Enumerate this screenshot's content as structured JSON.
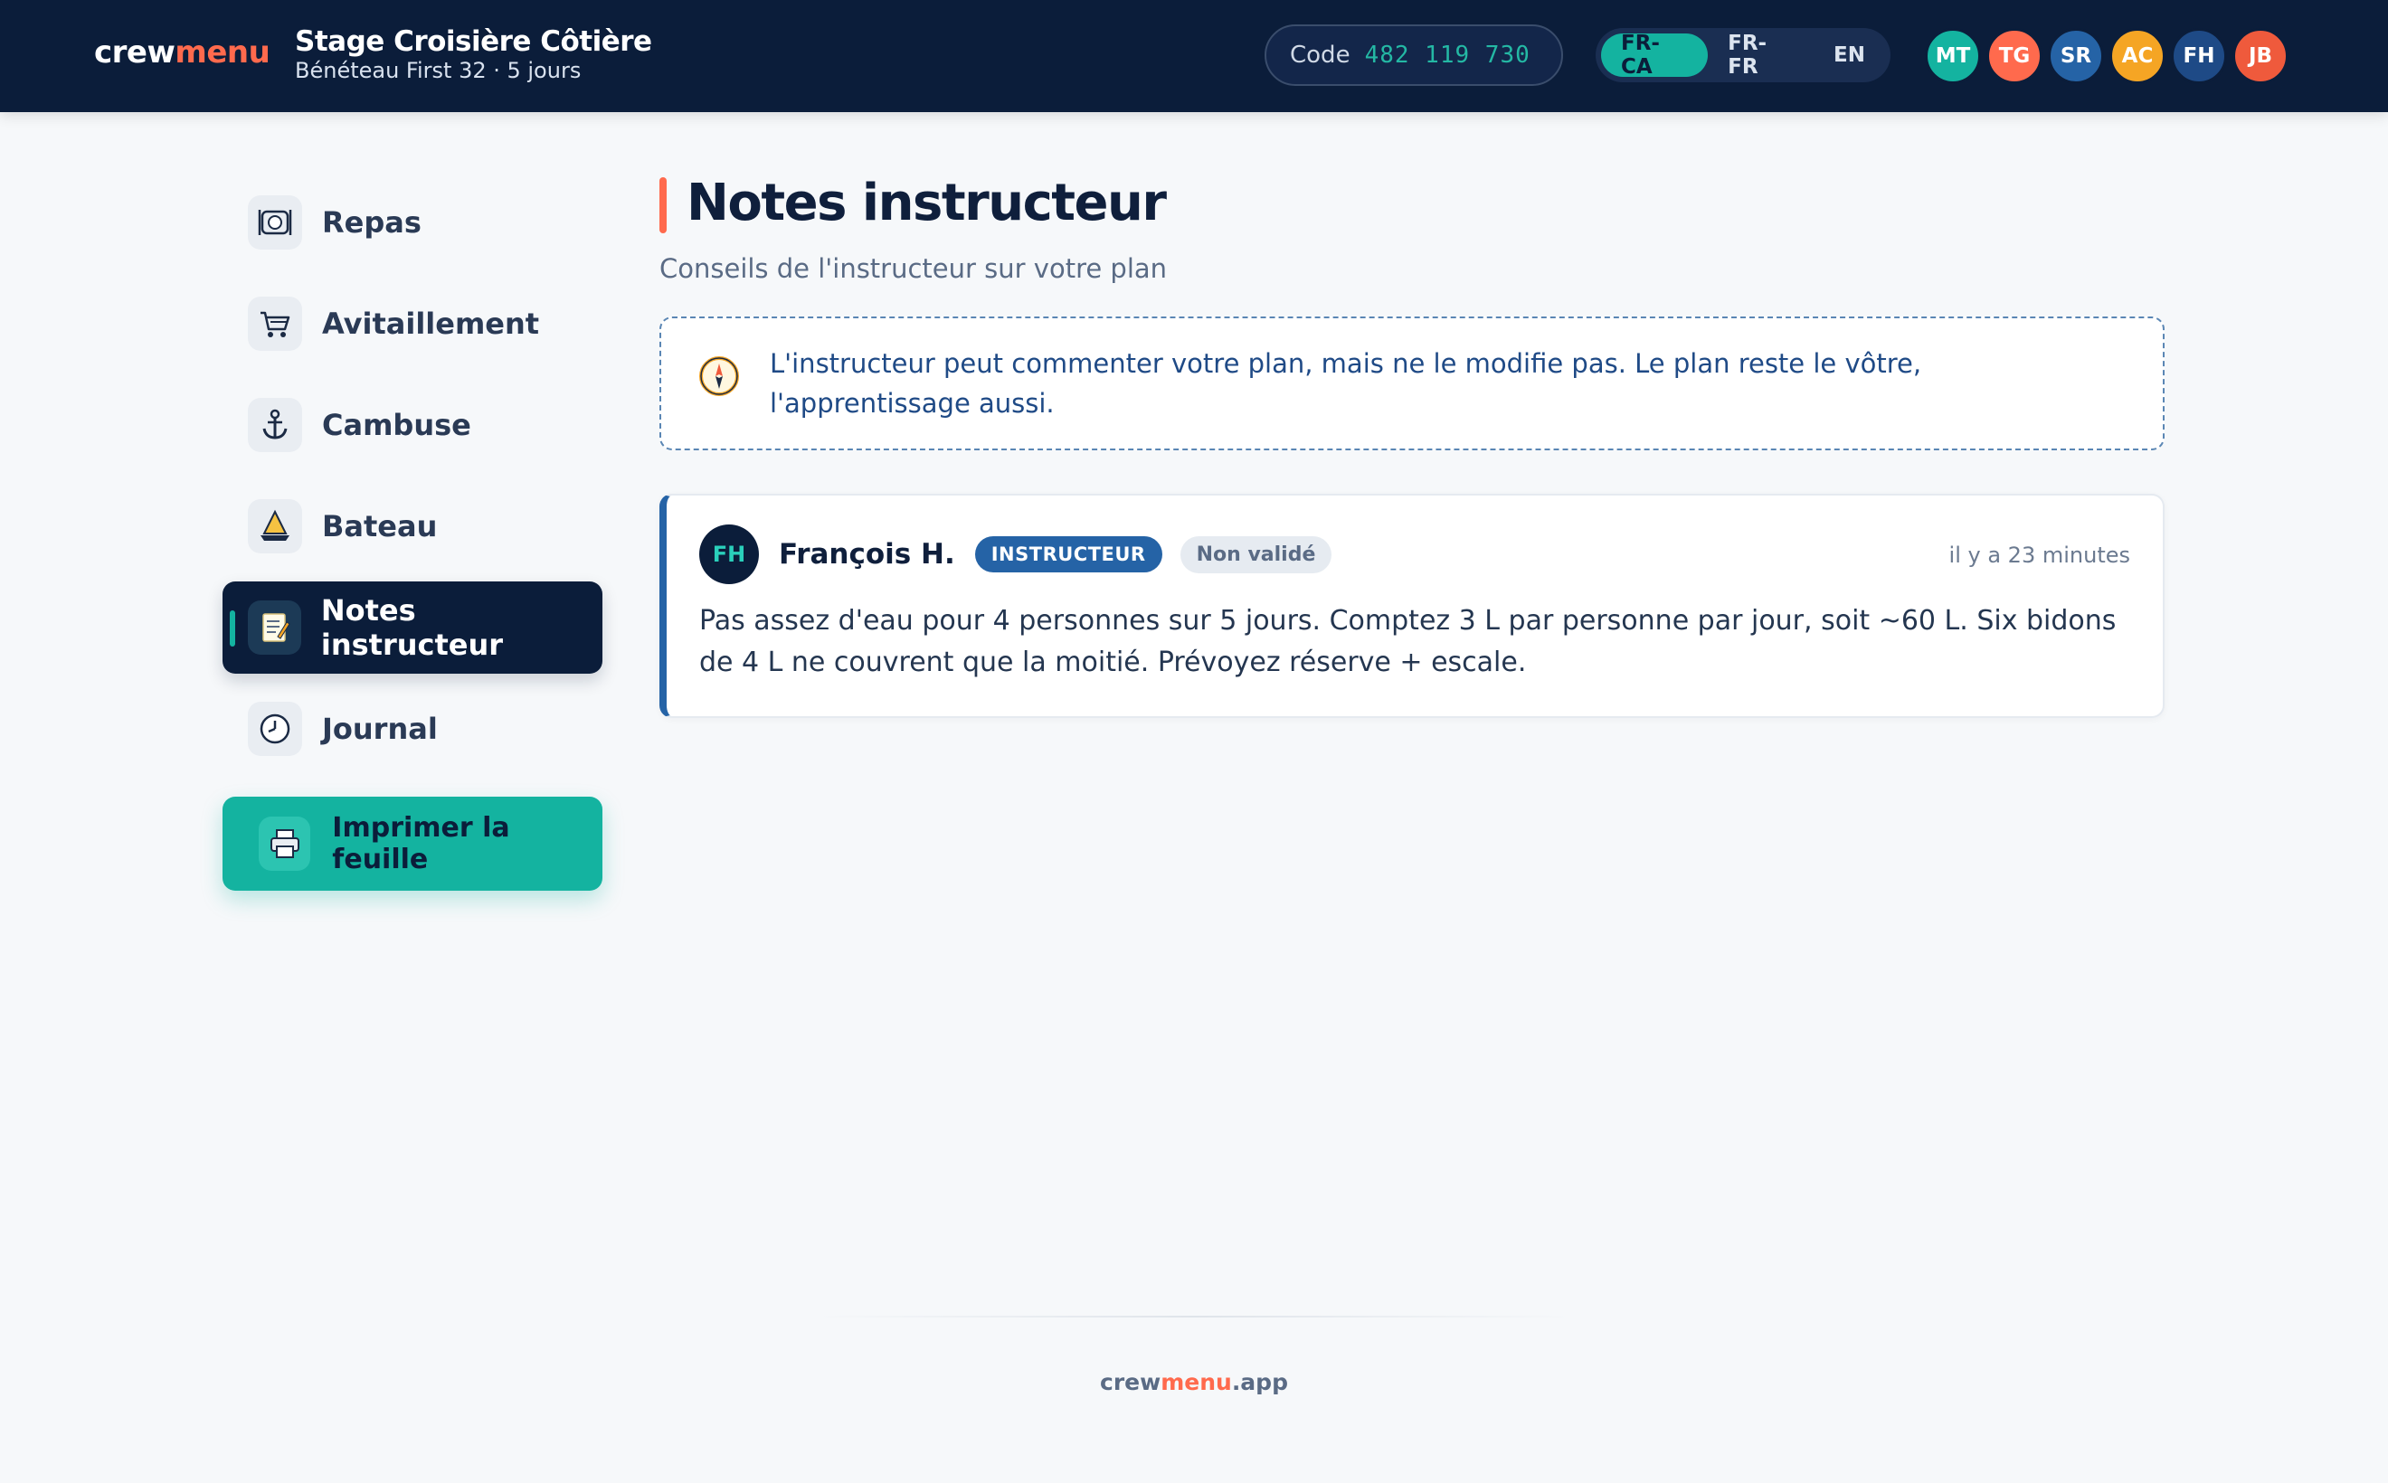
{
  "brand": {
    "part1": "crew",
    "part2": "menu"
  },
  "trip": {
    "title": "Stage Croisière Côtière",
    "subtitle": "Bénéteau First 32 · 5 jours"
  },
  "code": {
    "label": "Code",
    "value": "482 119 730"
  },
  "languages": [
    {
      "label": "FR-CA",
      "active": true
    },
    {
      "label": "FR-FR",
      "active": false
    },
    {
      "label": "EN",
      "active": false
    }
  ],
  "crew": [
    {
      "initials": "MT",
      "color": "#14b3a0"
    },
    {
      "initials": "TG",
      "color": "#ff6a4d"
    },
    {
      "initials": "SR",
      "color": "#2563a6"
    },
    {
      "initials": "AC",
      "color": "#f5a524"
    },
    {
      "initials": "FH",
      "color": "#1e4a86"
    },
    {
      "initials": "JB",
      "color": "#ef5a3c"
    }
  ],
  "sidebar": {
    "items": [
      {
        "label": "Repas",
        "icon": "plate-icon",
        "active": false
      },
      {
        "label": "Avitaillement",
        "icon": "cart-icon",
        "active": false
      },
      {
        "label": "Cambuse",
        "icon": "anchor-icon",
        "active": false
      },
      {
        "label": "Bateau",
        "icon": "sailboat-icon",
        "active": false
      },
      {
        "label": "Notes instructeur",
        "icon": "memo-icon",
        "active": true
      },
      {
        "label": "Journal",
        "icon": "clock-icon",
        "active": false
      }
    ],
    "print_label": "Imprimer la feuille"
  },
  "main": {
    "title": "Notes instructeur",
    "subtitle": "Conseils de l'instructeur sur votre plan",
    "info": "L'instructeur peut commenter votre plan, mais ne le modifie pas. Le plan reste le vôtre, l'apprentissage aussi."
  },
  "note": {
    "initials": "FH",
    "author": "François H.",
    "role": "INSTRUCTEUR",
    "status": "Non validé",
    "time": "il y a 23 minutes",
    "body": "Pas assez d'eau pour 4 personnes sur 5 jours. Comptez 3 L par personne par jour, soit ~60 L. Six bidons de 4 L ne couvrent que la moitié. Prévoyez réserve + escale."
  },
  "footer": {
    "part1": "crew",
    "part2": "menu",
    "part3": ".app"
  },
  "colors": {
    "navy": "#0b1d3a",
    "teal": "#14b3a0",
    "coral": "#ff6a4d",
    "blue": "#2563a6"
  }
}
